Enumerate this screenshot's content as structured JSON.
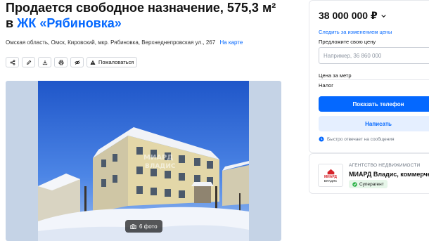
{
  "header": {
    "title_line1": "Продается свободное назначение, 575,3 м²",
    "title_prefix": "в",
    "complex_link": "ЖК «Рябиновка»"
  },
  "address": {
    "text": "Омская область, Омск, Кировский, мкр. Рябиновка, Верхнеднепровская ул., 267",
    "map_link": "На карте"
  },
  "actions": {
    "share": "share-icon",
    "edit": "pencil-icon",
    "download": "download-icon",
    "print": "printer-icon",
    "hide": "hide-icon",
    "complain": "Пожаловаться"
  },
  "gallery": {
    "photo_count": "6 фото"
  },
  "price_card": {
    "price": "38 000 000 ₽",
    "watch_price": "Следить за изменением цены",
    "offer_label": "Предложите свою цену",
    "offer_placeholder": "Например, 36 860 000",
    "price_per_meter_label": "Цена за метр",
    "tax_label": "Налог",
    "show_phone": "Показать телефон",
    "write": "Написать",
    "reply_note": "Быстро отвечает на сообщения"
  },
  "agency": {
    "type": "АГЕНТСТВО НЕДВИЖИМОСТИ",
    "name": "МИАРД Владис, коммерческая",
    "badge": "Суперагент",
    "logo_line1": "МИАРД",
    "logo_line2": "ВЛАДИС"
  },
  "colors": {
    "accent": "#0468ff",
    "accent_light": "#e5efff",
    "badge_green": "#2fb34a"
  }
}
